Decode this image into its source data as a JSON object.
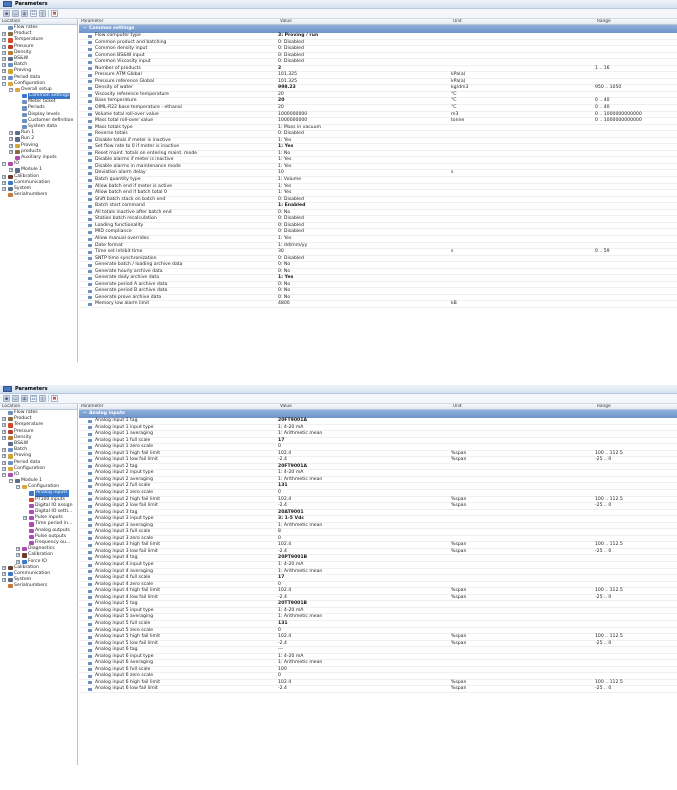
{
  "colors": {
    "accent": "#3a78c9",
    "section": "#7d9fd1"
  },
  "panel1": {
    "title": "Parameters",
    "toolbar": [
      "save-icon",
      "open-icon",
      "print-icon",
      "diagram-icon",
      "table-icon",
      "close-icon"
    ],
    "tree_header": "Location",
    "columns": [
      "Parameter",
      "Value",
      "Unit",
      "Range"
    ],
    "section": "Common settings",
    "tree": [
      {
        "label": "Flow rates",
        "level": 0,
        "exp": "",
        "color": "#6f8fbf",
        "icon": "flow-icon"
      },
      {
        "label": "Product",
        "level": 0,
        "exp": "+",
        "color": "#8a6c3e",
        "icon": "product-icon"
      },
      {
        "label": "Temperature",
        "level": 0,
        "exp": "+",
        "color": "#d34a2b",
        "icon": "thermometer-icon"
      },
      {
        "label": "Pressure",
        "level": 0,
        "exp": "+",
        "color": "#b8402b",
        "icon": "gauge-icon"
      },
      {
        "label": "Density",
        "level": 0,
        "exp": "+",
        "color": "#b87a2b",
        "icon": "density-icon"
      },
      {
        "label": "BS&W",
        "level": 0,
        "exp": "+",
        "color": "#5a6c88",
        "icon": "bsw-icon"
      },
      {
        "label": "Batch",
        "level": 0,
        "exp": "+",
        "color": "#6a8fc0",
        "icon": "batch-icon"
      },
      {
        "label": "Proving",
        "level": 0,
        "exp": "+",
        "color": "#d1a533",
        "icon": "trophy-icon"
      },
      {
        "label": "Period data",
        "level": 0,
        "exp": "+",
        "color": "#6f8fbf",
        "icon": "period-icon"
      },
      {
        "label": "Configuration",
        "level": 0,
        "exp": "−",
        "color": "#d9a640",
        "icon": "folder-icon"
      },
      {
        "label": "Overall setup",
        "level": 1,
        "exp": "−",
        "color": "#d9a640",
        "icon": "folder-icon"
      },
      {
        "label": "Common settings",
        "level": 2,
        "exp": "",
        "color": "#3a78c9",
        "icon": "settings-icon",
        "selected": true
      },
      {
        "label": "Meter ticket",
        "level": 2,
        "exp": "",
        "color": "#6f8fbf",
        "icon": "ticket-icon"
      },
      {
        "label": "Periods",
        "level": 2,
        "exp": "",
        "color": "#6f8fbf",
        "icon": "clock-icon"
      },
      {
        "label": "Display levels",
        "level": 2,
        "exp": "",
        "color": "#6f8fbf",
        "icon": "display-icon"
      },
      {
        "label": "Customer definition",
        "level": 2,
        "exp": "",
        "color": "#6f8fbf",
        "icon": "customer-icon"
      },
      {
        "label": "System data",
        "level": 2,
        "exp": "",
        "color": "#6f8fbf",
        "icon": "system-icon"
      },
      {
        "label": "Run 1",
        "level": 1,
        "exp": "+",
        "color": "#5a6c88",
        "icon": "run-icon"
      },
      {
        "label": "Run 2",
        "level": 1,
        "exp": "+",
        "color": "#5a6c88",
        "icon": "run-icon"
      },
      {
        "label": "Proving",
        "level": 1,
        "exp": "+",
        "color": "#d1a533",
        "icon": "trophy-icon"
      },
      {
        "label": "products",
        "level": 1,
        "exp": "+",
        "color": "#8a6c3e",
        "icon": "product-icon"
      },
      {
        "label": "Auxiliary inputs",
        "level": 1,
        "exp": "",
        "color": "#b04ab0",
        "icon": "aux-icon"
      },
      {
        "label": "IO",
        "level": 0,
        "exp": "−",
        "color": "#b04ab0",
        "icon": "io-icon"
      },
      {
        "label": "Module 1",
        "level": 1,
        "exp": "+",
        "color": "#5a6c88",
        "icon": "module-icon"
      },
      {
        "label": "Calibration",
        "level": 0,
        "exp": "+",
        "color": "#6b3a2b",
        "icon": "calibration-icon"
      },
      {
        "label": "Communication",
        "level": 0,
        "exp": "+",
        "color": "#3a78c9",
        "icon": "network-icon"
      },
      {
        "label": "System",
        "level": 0,
        "exp": "+",
        "color": "#5a6c88",
        "icon": "gear-icon"
      },
      {
        "label": "Serialnumbers",
        "level": 0,
        "exp": "",
        "color": "#c9783a",
        "icon": "serial-icon"
      }
    ],
    "rows": [
      [
        "Flow computer type",
        "3: Proving / run",
        "",
        "",
        true
      ],
      [
        "Common product and batching",
        "0: Disabled",
        "",
        "",
        false
      ],
      [
        "Common density input",
        "0: Disabled",
        "",
        "",
        false
      ],
      [
        "Common BS&W input",
        "0: Disabled",
        "",
        "",
        false
      ],
      [
        "Common Viscosity input",
        "0: Disabled",
        "",
        "",
        false
      ],
      [
        "Number of products",
        "2",
        "",
        "1 .. 16",
        true
      ],
      [
        "Pressure ATM Global",
        "101.325",
        "kPa(a)",
        "",
        false
      ],
      [
        "Pressure reference Global",
        "101.325",
        "kPa(a)",
        "",
        false
      ],
      [
        "Density of water",
        "998.23",
        "kg/dm3",
        "950 .. 1050",
        true
      ],
      [
        "Viscosity reference temperature",
        "20",
        "°C",
        "",
        false
      ],
      [
        "Base temperature",
        "20",
        "°C",
        "0 .. 40",
        true
      ],
      [
        "OIML-R22 base temperature - ethanol",
        "20",
        "°C",
        "0 .. 40",
        false
      ],
      [
        "Volume total roll-over value",
        "1000000000",
        "m3",
        "0 .. 1000000000000",
        false
      ],
      [
        "Mass total roll-over value",
        "1000000000",
        "tonne",
        "0 .. 1000000000000",
        false
      ],
      [
        "Mass totals type",
        "1: Mass in vacuum",
        "",
        "",
        false
      ],
      [
        "Reverse totals",
        "0: Disabled",
        "",
        "",
        false
      ],
      [
        "Disable totals if meter is inactive",
        "1: Yes",
        "",
        "",
        false
      ],
      [
        "Set flow rate to 0 if meter is inactive",
        "1: Yes",
        "",
        "",
        true
      ],
      [
        "Reset maint. totals on entering maint. mode",
        "1: No",
        "",
        "",
        false
      ],
      [
        "Disable alarms if meter is inactive",
        "1: Yes",
        "",
        "",
        false
      ],
      [
        "Disable alarms in maintenance mode",
        "1: Yes",
        "",
        "",
        false
      ],
      [
        "Deviation alarm delay",
        "10",
        "s",
        "",
        false
      ],
      [
        "Batch quantity type",
        "1: Volume",
        "",
        "",
        false
      ],
      [
        "Allow batch end if meter is active",
        "1: Yes",
        "",
        "",
        false
      ],
      [
        "Allow batch end if batch total 0",
        "1: Yes",
        "",
        "",
        false
      ],
      [
        "Shift batch stack on batch end",
        "0: Disabled",
        "",
        "",
        false
      ],
      [
        "Batch start command",
        "1: Enabled",
        "",
        "",
        true
      ],
      [
        "All totals inactive after batch end",
        "0: No",
        "",
        "",
        false
      ],
      [
        "Station batch recalculation",
        "0: Disabled",
        "",
        "",
        false
      ],
      [
        "Loading functionality",
        "0: Disabled",
        "",
        "",
        false
      ],
      [
        "MID compliance",
        "0: Disabled",
        "",
        "",
        false
      ],
      [
        "Allow manual overrides",
        "1: Yes",
        "",
        "",
        false
      ],
      [
        "Date format",
        "1: dd/mm/yy",
        "",
        "",
        false
      ],
      [
        "Time set inhibit time",
        "30",
        "s",
        "0 .. 59",
        false
      ],
      [
        "SNTP time synchronization",
        "0: Disabled",
        "",
        "",
        false
      ],
      [
        "Generate batch / loading archive data",
        "0: No",
        "",
        "",
        false
      ],
      [
        "Generate hourly archive data",
        "0: No",
        "",
        "",
        false
      ],
      [
        "Generate daily archive data",
        "1: Yes",
        "",
        "",
        true
      ],
      [
        "Generate period A archive data",
        "0: No",
        "",
        "",
        false
      ],
      [
        "Generate period B archive data",
        "0: No",
        "",
        "",
        false
      ],
      [
        "Generate prove archive data",
        "0: No",
        "",
        "",
        false
      ],
      [
        "Memory low alarm limit",
        "4800",
        "kB",
        "",
        false
      ]
    ]
  },
  "panel2": {
    "title": "Parameters",
    "toolbar": [
      "save-icon",
      "open-icon",
      "print-icon",
      "diagram-icon",
      "table-icon",
      "close-icon"
    ],
    "tree_header": "Location",
    "columns": [
      "Parameter",
      "Value",
      "Unit",
      "Range"
    ],
    "section": "Analog inputs",
    "tree": [
      {
        "label": "Flow rates",
        "level": 0,
        "exp": "",
        "color": "#6f8fbf",
        "icon": "flow-icon"
      },
      {
        "label": "Product",
        "level": 0,
        "exp": "+",
        "color": "#8a6c3e",
        "icon": "product-icon"
      },
      {
        "label": "Temperature",
        "level": 0,
        "exp": "+",
        "color": "#d34a2b",
        "icon": "thermometer-icon"
      },
      {
        "label": "Pressure",
        "level": 0,
        "exp": "+",
        "color": "#b8402b",
        "icon": "gauge-icon"
      },
      {
        "label": "Density",
        "level": 0,
        "exp": "+",
        "color": "#b87a2b",
        "icon": "density-icon"
      },
      {
        "label": "BS&W",
        "level": 0,
        "exp": "",
        "color": "#5a6c88",
        "icon": "bsw-icon"
      },
      {
        "label": "Batch",
        "level": 0,
        "exp": "+",
        "color": "#6a8fc0",
        "icon": "batch-icon"
      },
      {
        "label": "Proving",
        "level": 0,
        "exp": "+",
        "color": "#d1a533",
        "icon": "trophy-icon"
      },
      {
        "label": "Period data",
        "level": 0,
        "exp": "+",
        "color": "#6f8fbf",
        "icon": "period-icon"
      },
      {
        "label": "Configuration",
        "level": 0,
        "exp": "+",
        "color": "#d9a640",
        "icon": "folder-icon"
      },
      {
        "label": "IO",
        "level": 0,
        "exp": "−",
        "color": "#b04ab0",
        "icon": "io-icon"
      },
      {
        "label": "Module 1",
        "level": 1,
        "exp": "−",
        "color": "#5a6c88",
        "icon": "module-icon"
      },
      {
        "label": "Configuration",
        "level": 2,
        "exp": "−",
        "color": "#d9a640",
        "icon": "folder-icon"
      },
      {
        "label": "Analog inputs",
        "level": 3,
        "exp": "",
        "color": "#3a78c9",
        "icon": "analog-icon",
        "selected": true
      },
      {
        "label": "PT100 inputs",
        "level": 3,
        "exp": "",
        "color": "#d34a2b",
        "icon": "thermometer-icon"
      },
      {
        "label": "Digital IO assign",
        "level": 3,
        "exp": "",
        "color": "#b04ab0",
        "icon": "digital-icon"
      },
      {
        "label": "Digital IO setti...",
        "level": 3,
        "exp": "",
        "color": "#b04ab0",
        "icon": "digital-icon"
      },
      {
        "label": "Pulse inputs",
        "level": 3,
        "exp": "+",
        "color": "#b04ab0",
        "icon": "pulse-icon"
      },
      {
        "label": "Time period in...",
        "level": 3,
        "exp": "",
        "color": "#b04ab0",
        "icon": "pulse-icon"
      },
      {
        "label": "Analog outputs",
        "level": 3,
        "exp": "",
        "color": "#b04ab0",
        "icon": "analog-out-icon"
      },
      {
        "label": "Pulse outputs",
        "level": 3,
        "exp": "",
        "color": "#b04ab0",
        "icon": "pulse-icon"
      },
      {
        "label": "Frequency ou...",
        "level": 3,
        "exp": "",
        "color": "#b04ab0",
        "icon": "frequency-icon"
      },
      {
        "label": "Diagnostics",
        "level": 2,
        "exp": "+",
        "color": "#b04ab0",
        "icon": "diagnostics-icon"
      },
      {
        "label": "Calibration",
        "level": 2,
        "exp": "+",
        "color": "#6b3a2b",
        "icon": "calibration-icon"
      },
      {
        "label": "Force IO",
        "level": 2,
        "exp": "+",
        "color": "#3a78c9",
        "icon": "force-icon"
      },
      {
        "label": "Calibration",
        "level": 0,
        "exp": "+",
        "color": "#6b3a2b",
        "icon": "calibration-icon"
      },
      {
        "label": "Communication",
        "level": 0,
        "exp": "+",
        "color": "#3a78c9",
        "icon": "network-icon"
      },
      {
        "label": "System",
        "level": 0,
        "exp": "+",
        "color": "#5a6c88",
        "icon": "gear-icon"
      },
      {
        "label": "Serialnumbers",
        "level": 0,
        "exp": "",
        "color": "#c9783a",
        "icon": "serial-icon"
      }
    ],
    "rows": [
      [
        "Analog input 1 tag",
        "20FT9001A",
        "",
        "",
        true
      ],
      [
        "Analog input 1 input type",
        "1: 4-20 mA",
        "",
        "",
        false
      ],
      [
        "Analog input 1 averaging",
        "1: Arithmetic mean",
        "",
        "",
        false
      ],
      [
        "Analog input 1 full scale",
        "17",
        "",
        "",
        true
      ],
      [
        "Analog input 1 zero scale",
        "0",
        "",
        "",
        false
      ],
      [
        "Analog input 1 high fail limit",
        "102.4",
        "%span",
        "100 .. 112.5",
        false
      ],
      [
        "Analog input 1 low fail limit",
        "-2.4",
        "%span",
        "-25 .. 0",
        false
      ],
      [
        "Analog input 2 tag",
        "20FT9001A",
        "",
        "",
        true
      ],
      [
        "Analog input 2 input type",
        "1: 4-20 mA",
        "",
        "",
        false
      ],
      [
        "Analog input 2 averaging",
        "1: Arithmetic mean",
        "",
        "",
        false
      ],
      [
        "Analog input 2 full scale",
        "131",
        "",
        "",
        true
      ],
      [
        "Analog input 2 zero scale",
        "0",
        "",
        "",
        false
      ],
      [
        "Analog input 2 high fail limit",
        "102.4",
        "%span",
        "100 .. 112.5",
        false
      ],
      [
        "Analog input 2 low fail limit",
        "-2.4",
        "%span",
        "-25 .. 0",
        false
      ],
      [
        "Analog input 3 tag",
        "20AT9001",
        "",
        "",
        true
      ],
      [
        "Analog input 3 input type",
        "3: 1-5 Vdc",
        "",
        "",
        true
      ],
      [
        "Analog input 3 averaging",
        "1: Arithmetic mean",
        "",
        "",
        false
      ],
      [
        "Analog input 3 full scale",
        "8",
        "",
        "",
        false
      ],
      [
        "Analog input 3 zero scale",
        "0",
        "",
        "",
        false
      ],
      [
        "Analog input 3 high fail limit",
        "102.4",
        "%span",
        "100 .. 112.5",
        false
      ],
      [
        "Analog input 3 low fail limit",
        "-2.4",
        "%span",
        "-25 .. 0",
        false
      ],
      [
        "Analog input 4 tag",
        "20PT9001B",
        "",
        "",
        true
      ],
      [
        "Analog input 4 input type",
        "1: 4-20 mA",
        "",
        "",
        false
      ],
      [
        "Analog input 4 averaging",
        "1: Arithmetic mean",
        "",
        "",
        false
      ],
      [
        "Analog input 4 full scale",
        "17",
        "",
        "",
        true
      ],
      [
        "Analog input 4 zero scale",
        "0",
        "",
        "",
        false
      ],
      [
        "Analog input 4 high fail limit",
        "102.4",
        "%span",
        "100 .. 112.5",
        false
      ],
      [
        "Analog input 4 low fail limit",
        "-2.4",
        "%span",
        "-25 .. 0",
        false
      ],
      [
        "Analog input 5 tag",
        "20TT9001B",
        "",
        "",
        true
      ],
      [
        "Analog input 5 input type",
        "1: 4-20 mA",
        "",
        "",
        false
      ],
      [
        "Analog input 5 averaging",
        "1: Arithmetic mean",
        "",
        "",
        false
      ],
      [
        "Analog input 5 full scale",
        "131",
        "",
        "",
        true
      ],
      [
        "Analog input 5 zero scale",
        "0",
        "",
        "",
        false
      ],
      [
        "Analog input 5 high fail limit",
        "102.4",
        "%span",
        "100 .. 112.5",
        false
      ],
      [
        "Analog input 5 low fail limit",
        "-2.4",
        "%span",
        "-25 .. 0",
        false
      ],
      [
        "Analog input 6 tag",
        "---",
        "",
        "",
        false
      ],
      [
        "Analog input 6 input type",
        "1: 4-20 mA",
        "",
        "",
        false
      ],
      [
        "Analog input 6 averaging",
        "1: Arithmetic mean",
        "",
        "",
        false
      ],
      [
        "Analog input 6 full scale",
        "100",
        "",
        "",
        false
      ],
      [
        "Analog input 6 zero scale",
        "0",
        "",
        "",
        false
      ],
      [
        "Analog input 6 high fail limit",
        "102.4",
        "%span",
        "100 .. 112.5",
        false
      ],
      [
        "Analog input 6 low fail limit",
        "-2.4",
        "%span",
        "-25 .. 0",
        false
      ]
    ]
  }
}
